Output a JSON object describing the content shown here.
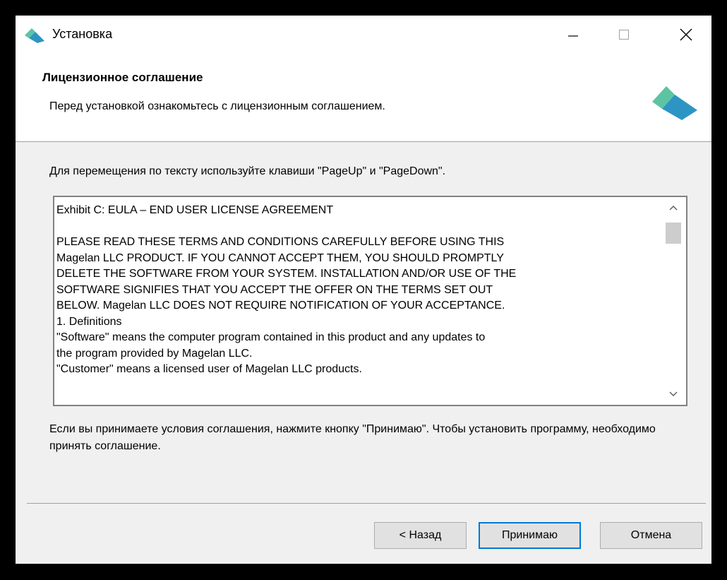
{
  "window": {
    "title": "Установка",
    "accent_color": "#0078d7",
    "logo_colors": [
      "#2d95c4",
      "#5cc4a3"
    ]
  },
  "header": {
    "title": "Лицензионное соглашение",
    "subtitle": "Перед установкой ознакомьтесь с лицензионным соглашением."
  },
  "hint": "Для перемещения по тексту используйте клавиши \"PageUp\" и \"PageDown\".",
  "license": {
    "text": "Exhibit C: EULA – END USER LICENSE AGREEMENT\n\nPLEASE READ THESE TERMS AND CONDITIONS CAREFULLY BEFORE USING THIS\nMagelan LLC PRODUCT. IF YOU CANNOT ACCEPT THEM, YOU SHOULD PROMPTLY\nDELETE THE SOFTWARE FROM YOUR SYSTEM. INSTALLATION AND/OR USE OF THE\nSOFTWARE SIGNIFIES THAT  YOU ACCEPT THE OFFER ON THE TERMS SET OUT\nBELOW.  Magelan LLC DOES NOT REQUIRE NOTIFICATION OF YOUR ACCEPTANCE.\n1. Definitions\n\"Software\" means the computer program contained in this product and any updates to\nthe program provided by Magelan LLC.\n\"Customer\" means a licensed user of Magelan LLC products."
  },
  "accept_note": "Если вы принимаете условия соглашения, нажмите кнопку \"Принимаю\". Чтобы установить программу, необходимо принять соглашение.",
  "buttons": {
    "back": "< Назад",
    "accept": "Принимаю",
    "cancel": "Отмена"
  }
}
